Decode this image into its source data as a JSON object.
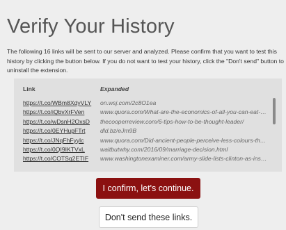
{
  "title": "Verify Your History",
  "intro": "The following 16 links will be sent to our server and analyzed. Please confirm that you want to test this history by clicking the button below. If you do not want to test your history, click the \"Don't send\" button to uninstall the extension.",
  "table": {
    "col_link": "Link",
    "col_expanded": "Expanded",
    "rows": [
      {
        "short": "https://t.co/WBm8XdyVLY",
        "expanded": "on.wsj.com/2c8O1ea"
      },
      {
        "short": "https://t.co/iQbvXrFVen",
        "expanded": "www.quora.com/What-are-the-economics-of-all-you-can-eat-buff..."
      },
      {
        "short": "https://t.co/wDsnH2OxsD",
        "expanded": "thecooperreview.com/6-tips-how-to-be-thought-leader/"
      },
      {
        "short": "https://t.co/0EYHupFTrt",
        "expanded": "dld.bz/eJm9B"
      },
      {
        "short": "https://t.co/JNqFhFyylc",
        "expanded": "www.quora.com/Did-ancient-people-perceive-less-colours-than-..."
      },
      {
        "short": "https://t.co/0QI9IKTVxL",
        "expanded": "waitbutwhy.com/2016/09/marriage-decision.html"
      },
      {
        "short": "https://t.co/COTSq2ETIF",
        "expanded": "www.washingtonexaminer.com/army-slide-lists-clinton-as-insid..."
      }
    ]
  },
  "buttons": {
    "confirm": "I confirm, let's continue.",
    "decline": "Don't send these links."
  }
}
